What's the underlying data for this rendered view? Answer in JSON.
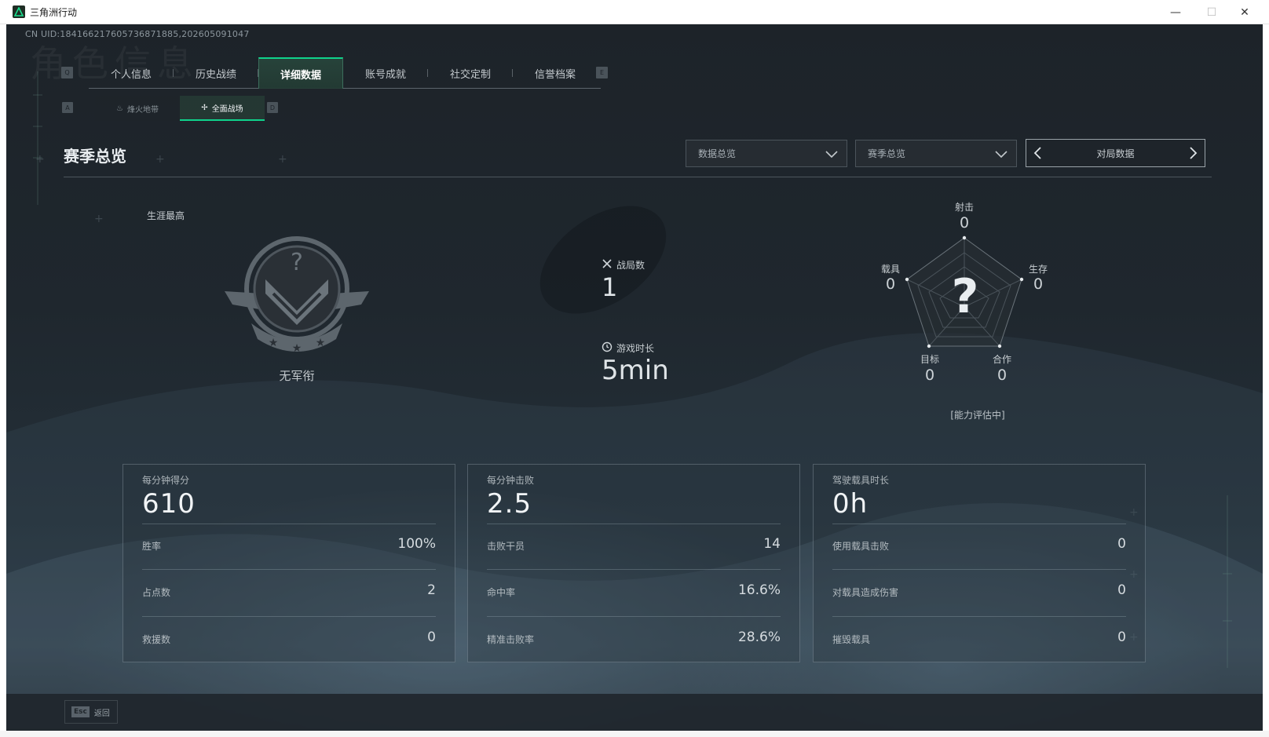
{
  "window": {
    "title": "三角洲行动",
    "minimize": "—",
    "maximize": "☐",
    "close": "✕"
  },
  "uid": "CN UID:18416621760573687188​5,202605091047",
  "ghost_title": "角色信息",
  "tabs": {
    "key_left": "Q",
    "key_right": "E",
    "items": [
      {
        "label": "个人信息"
      },
      {
        "label": "历史战绩"
      },
      {
        "label": "详细数据"
      },
      {
        "label": "账号成就"
      },
      {
        "label": "社交定制"
      },
      {
        "label": "信誉档案"
      }
    ]
  },
  "subtabs": {
    "key_left": "A",
    "key_right": "D",
    "items": [
      {
        "label": "烽火地带"
      },
      {
        "label": "全面战场"
      }
    ]
  },
  "section_title": "赛季总览",
  "filters": {
    "data_dropdown": "数据总览",
    "season_dropdown": "赛季总览",
    "pager_label": "对局数据"
  },
  "overview": {
    "career_label": "生涯最高",
    "rank_name": "无军衔",
    "matches_label": "战局数",
    "matches_value": "1",
    "playtime_label": "游戏时长",
    "playtime_value": "5min"
  },
  "radar": {
    "center_glyph": "?",
    "evaluation": "[能力评估中]",
    "axes": [
      {
        "label": "射击",
        "value": "0"
      },
      {
        "label": "生存",
        "value": "0"
      },
      {
        "label": "合作",
        "value": "0"
      },
      {
        "label": "目标",
        "value": "0"
      },
      {
        "label": "载具",
        "value": "0"
      }
    ]
  },
  "cards": [
    {
      "title": "每分钟得分",
      "value": "610",
      "rows": [
        {
          "label": "胜率",
          "value": "100%"
        },
        {
          "label": "占点数",
          "value": "2"
        },
        {
          "label": "救援数",
          "value": "0"
        }
      ]
    },
    {
      "title": "每分钟击败",
      "value": "2.5",
      "rows": [
        {
          "label": "击败干员",
          "value": "14"
        },
        {
          "label": "命中率",
          "value": "16.6%"
        },
        {
          "label": "精准击败率",
          "value": "28.6%"
        }
      ]
    },
    {
      "title": "驾驶载具时长",
      "value": "0h",
      "rows": [
        {
          "label": "使用载具击败",
          "value": "0"
        },
        {
          "label": "对载具造成伤害",
          "value": "0"
        },
        {
          "label": "摧毁载具",
          "value": "0"
        }
      ]
    }
  ],
  "footer": {
    "esc_key": "Esc",
    "back_label": "返回"
  },
  "colors": {
    "accent": "#0fd38c",
    "background": "#1f272e"
  }
}
